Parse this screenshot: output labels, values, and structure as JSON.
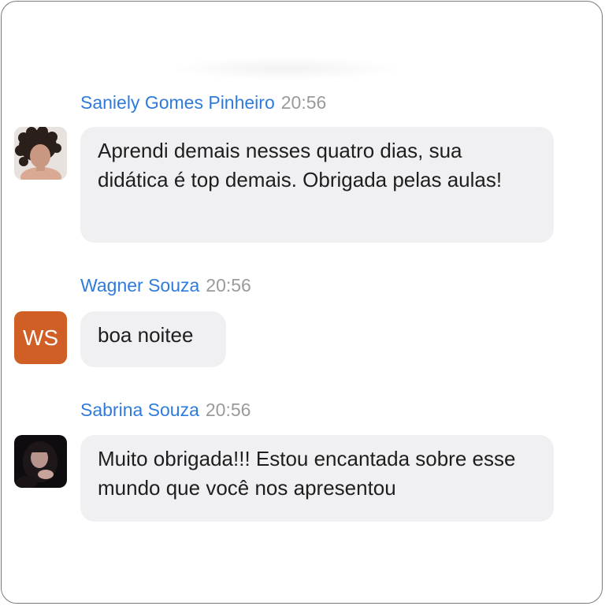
{
  "messages": [
    {
      "sender": "Saniely Gomes Pinheiro",
      "time": "20:56",
      "avatar": {
        "type": "photo",
        "icon": "user-photo-curly-hair-icon"
      },
      "text": "Aprendi demais nesses quatro dias, sua didática é top demais. Obrigada pelas aulas!"
    },
    {
      "sender": "Wagner Souza",
      "time": "20:56",
      "avatar": {
        "type": "initials",
        "initials": "WS",
        "color": "#d05f25"
      },
      "text": "boa noitee"
    },
    {
      "sender": "Sabrina Souza",
      "time": "20:56",
      "avatar": {
        "type": "photo",
        "icon": "user-photo-dark-icon"
      },
      "text": "Muito obrigada!!! Estou encantada sobre esse mundo que você nos apresentou"
    }
  ],
  "colors": {
    "sender": "#2f7bdc",
    "time": "#9a9a9a",
    "bubble": "#f0f0f2",
    "text": "#1e1e1e"
  }
}
